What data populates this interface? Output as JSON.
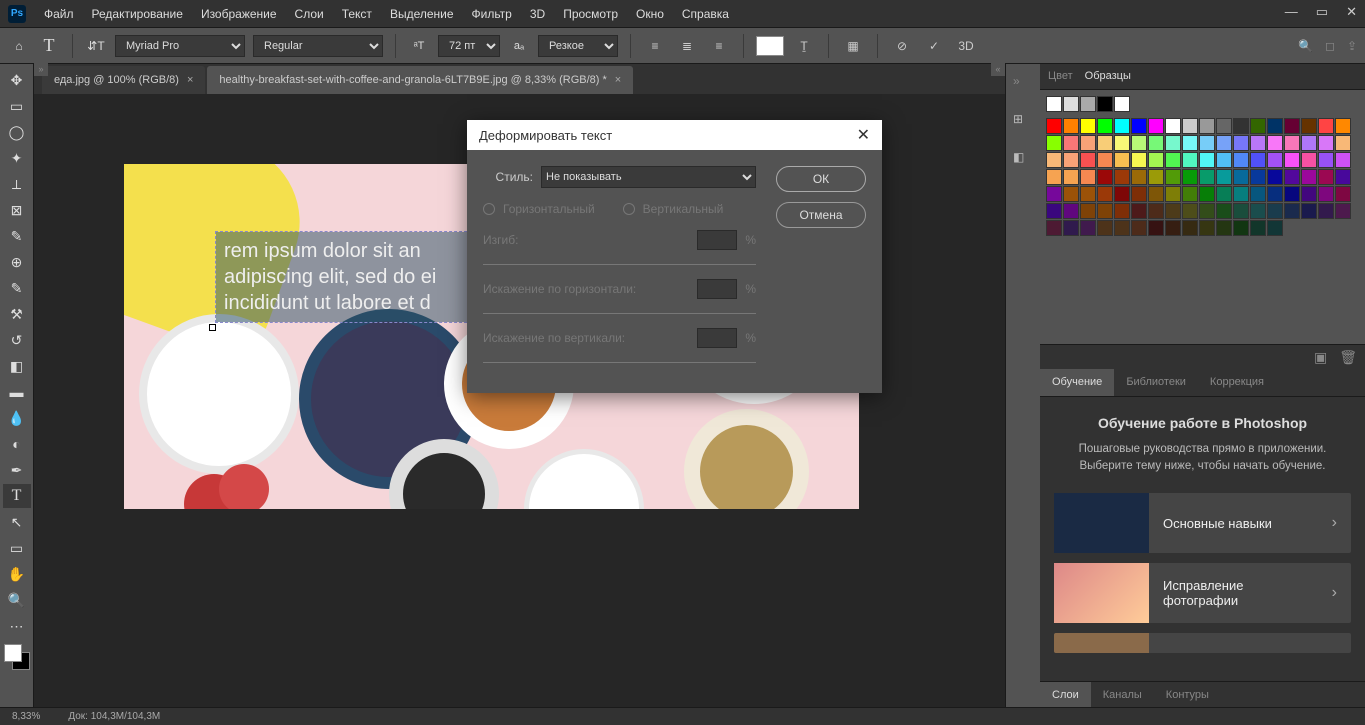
{
  "menu": {
    "file": "Файл",
    "edit": "Редактирование",
    "image": "Изображение",
    "layers": "Слои",
    "text": "Текст",
    "select": "Выделение",
    "filter": "Фильтр",
    "threed": "3D",
    "view": "Просмотр",
    "window": "Окно",
    "help": "Справка"
  },
  "opt": {
    "font": "Myriad Pro",
    "weight": "Regular",
    "size": "72 пт",
    "aa": "Резкое",
    "threed": "3D"
  },
  "tabs": [
    {
      "label": "еда.jpg @ 100% (RGB/8)"
    },
    {
      "label": "healthy-breakfast-set-with-coffee-and-granola-6LT7B9E.jpg @ 8,33% (RGB/8) *"
    }
  ],
  "dialog": {
    "title": "Деформировать текст",
    "styleLabel": "Стиль:",
    "styleValue": "Не показывать",
    "horiz": "Горизонтальный",
    "vert": "Вертикальный",
    "bend": "Изгиб:",
    "hdist": "Искажение по горизонтали:",
    "vdist": "Искажение по вертикали:",
    "pct": "%",
    "ok": "ОК",
    "cancel": "Отмена"
  },
  "rightTabs": {
    "color": "Цвет",
    "swatches": "Образцы"
  },
  "learnTabs": {
    "learn": "Обучение",
    "lib": "Библиотеки",
    "corr": "Коррекция"
  },
  "learn": {
    "title": "Обучение работе в Photoshop",
    "sub": "Пошаговые руководства прямо в приложении. Выберите тему ниже, чтобы начать обучение.",
    "card1": "Основные навыки",
    "card2": "Исправление фотографии"
  },
  "bottomTabs": {
    "layers": "Слои",
    "channels": "Каналы",
    "paths": "Контуры"
  },
  "status": {
    "zoom": "8,33%",
    "doc": "Док: 104,3M/104,3M"
  },
  "canvasText": "  rem ipsum dolor sit an\nadipiscing elit, sed do ei\nincididunt ut labore et d",
  "chart_data": null
}
